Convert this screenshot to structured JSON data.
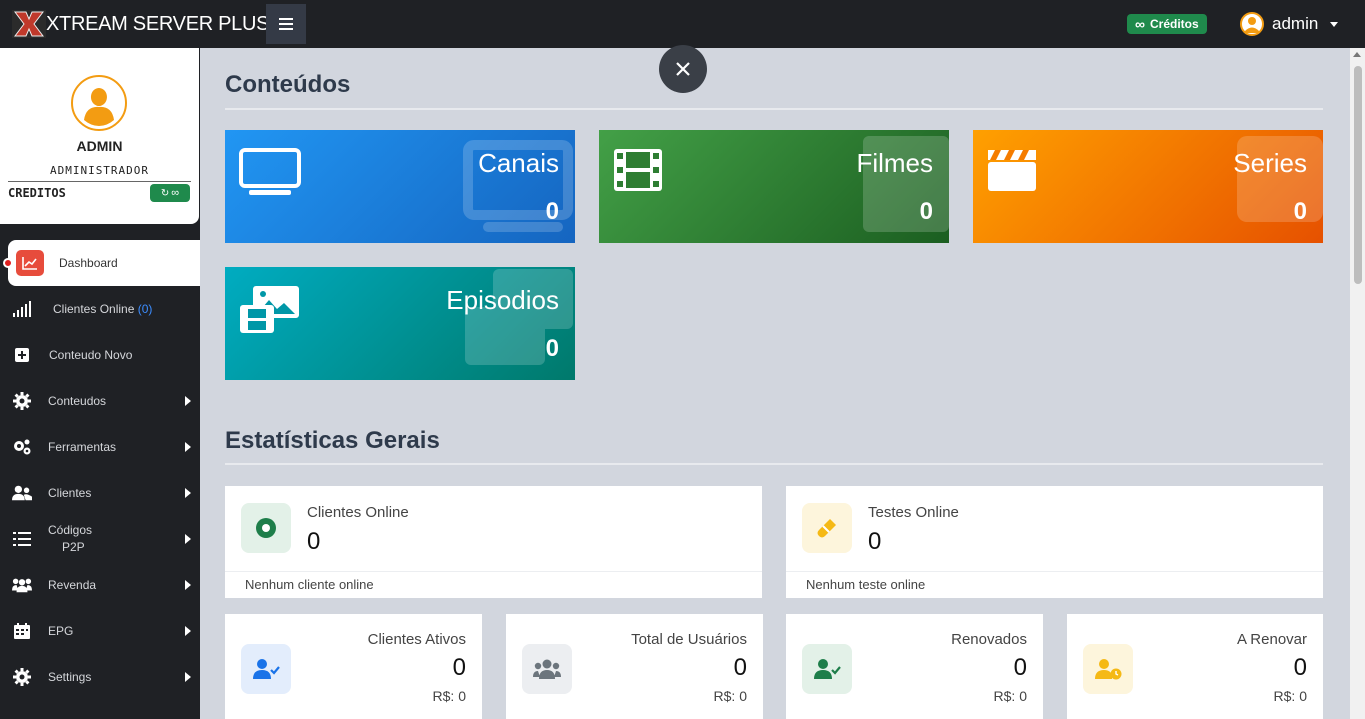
{
  "header": {
    "brand_title": "XTREAM SERVER PLUS+",
    "credits_badge": "Créditos",
    "username": "admin"
  },
  "sidebar": {
    "profile": {
      "name": "ADMIN",
      "role": "ADMINISTRADOR",
      "credits_label": "CREDITOS",
      "credits_value": "∞"
    },
    "items": [
      {
        "label": "Dashboard",
        "icon": "chart-line-icon",
        "active": true
      },
      {
        "label": "Clientes Online",
        "count": "(0)",
        "icon": "signal-bars-icon"
      },
      {
        "label": "Conteudo Novo",
        "icon": "plus-square-icon"
      },
      {
        "label": "Conteudos",
        "icon": "gear-icon",
        "submenu": true
      },
      {
        "label": "Ferramentas",
        "icon": "gears-icon",
        "submenu": true
      },
      {
        "label": "Clientes",
        "icon": "users-icon",
        "submenu": true
      },
      {
        "label": "Códigos",
        "label2": "P2P",
        "icon": "list-icon",
        "submenu": true
      },
      {
        "label": "Revenda",
        "icon": "users-group-icon",
        "submenu": true
      },
      {
        "label": "EPG",
        "icon": "calendar-icon",
        "submenu": true
      },
      {
        "label": "Settings",
        "icon": "gear-icon",
        "submenu": true
      }
    ]
  },
  "content": {
    "section_title": "Conteúdos",
    "tiles": [
      {
        "label": "Canais",
        "value": "0",
        "icon": "tv-icon",
        "color_from": "#1e88e5",
        "color_to": "#1565c0"
      },
      {
        "label": "Filmes",
        "value": "0",
        "icon": "film-icon",
        "color_from": "#43a047",
        "color_to": "#1b5e20"
      },
      {
        "label": "Series",
        "value": "0",
        "icon": "clapperboard-icon",
        "color_from": "#ff9800",
        "color_to": "#e65100"
      },
      {
        "label": "Episodios",
        "value": "0",
        "icon": "images-icon",
        "color_from": "#00acc1",
        "color_to": "#00796b"
      }
    ]
  },
  "stats": {
    "section_title": "Estatísticas Gerais",
    "top_cards": [
      {
        "label": "Clientes Online",
        "value": "0",
        "footer": "Nenhum cliente online",
        "icon": "online-dot-icon"
      },
      {
        "label": "Testes Online",
        "value": "0",
        "footer": "Nenhum teste online",
        "icon": "test-tube-icon"
      }
    ],
    "bottom_cards": [
      {
        "label": "Clientes Ativos",
        "value": "0",
        "money": "R$: 0",
        "icon": "user-check-icon"
      },
      {
        "label": "Total de Usuários",
        "value": "0",
        "money": "R$: 0",
        "icon": "users-icon"
      },
      {
        "label": "Renovados",
        "value": "0",
        "money": "R$: 0",
        "icon": "user-check-icon"
      },
      {
        "label": "A Renovar",
        "value": "0",
        "money": "R$: 0",
        "icon": "user-clock-icon"
      }
    ]
  }
}
